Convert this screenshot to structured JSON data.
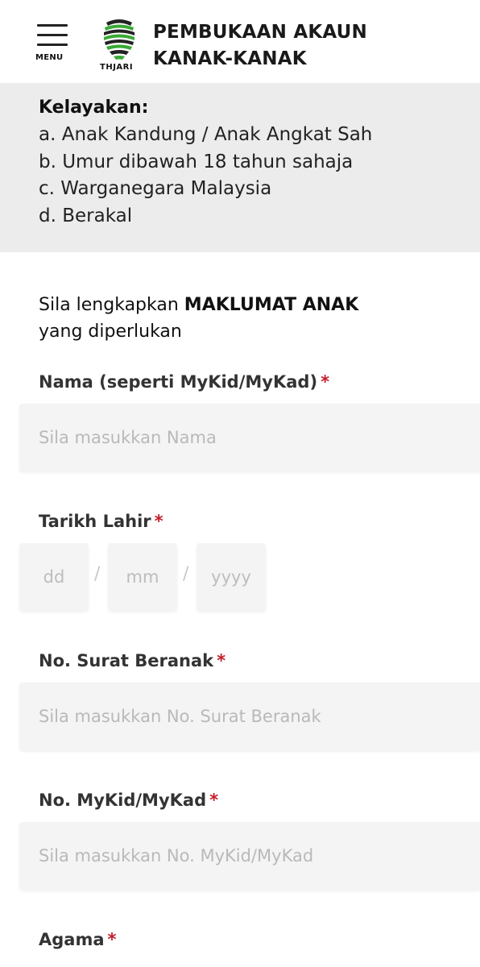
{
  "header": {
    "menu_label": "MENU",
    "logo_text": "THJARI",
    "title_line1": "PEMBUKAAN AKAUN",
    "title_line2": "KANAK-KANAK"
  },
  "eligibility": {
    "title": "Kelayakan:",
    "items": [
      "a. Anak Kandung / Anak Angkat Sah",
      "b. Umur dibawah 18 tahun sahaja",
      "c. Warganegara Malaysia",
      "d. Berakal"
    ]
  },
  "intro": {
    "prefix": "Sila lengkapkan ",
    "emphasis": "MAKLUMAT ANAK",
    "suffix": "yang diperlukan"
  },
  "form": {
    "required_mark": "*",
    "name": {
      "label": "Nama (seperti MyKid/MyKad)",
      "placeholder": "Sila masukkan Nama"
    },
    "dob": {
      "label": "Tarikh Lahir",
      "dd": "dd",
      "mm": "mm",
      "yyyy": "yyyy",
      "separator": "/"
    },
    "birth_cert": {
      "label": "No. Surat Beranak",
      "placeholder": "Sila masukkan No. Surat Beranak"
    },
    "mykid": {
      "label": "No. MyKid/MyKad",
      "placeholder": "Sila masukkan No. MyKid/MyKad"
    },
    "religion": {
      "label": "Agama"
    }
  },
  "colors": {
    "required": "#c41e2a",
    "logo_green": "#3aa935",
    "panel_bg": "#ececec",
    "input_bg": "#f4f4f4"
  }
}
